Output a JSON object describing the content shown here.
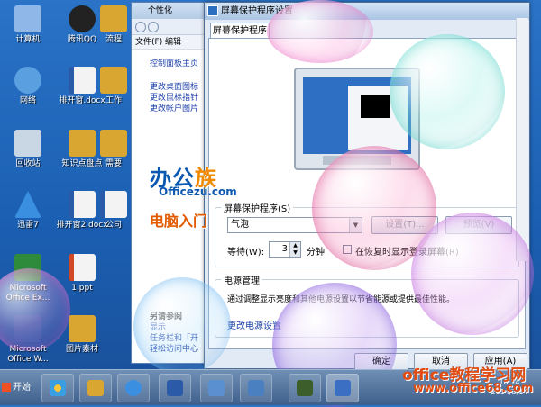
{
  "desktop": {
    "icons": [
      {
        "label": "计算机"
      },
      {
        "label": "腾讯QQ"
      },
      {
        "label": "流程"
      },
      {
        "label": "网络"
      },
      {
        "label": "排开窗.docx"
      },
      {
        "label": "工作"
      },
      {
        "label": "回收站"
      },
      {
        "label": "知识点盘点"
      },
      {
        "label": "需要"
      },
      {
        "label": "迅雷7"
      },
      {
        "label": "排开窗2.docx"
      },
      {
        "label": "公司"
      },
      {
        "label": "Microsoft Office Ex..."
      },
      {
        "label": "1.ppt"
      },
      {
        "label": "Microsoft Office W..."
      },
      {
        "label": "图片素材"
      }
    ]
  },
  "explorer": {
    "title": "个性化",
    "menu": "文件(F)    编辑",
    "home_link": "控制面板主页",
    "links": [
      "更改桌面图标",
      "更改鼠标指针",
      "更改帐户图片"
    ],
    "see_also_title": "另请参阅",
    "see_also": [
      "显示",
      "任务栏和「开",
      "轻松访问中心"
    ]
  },
  "dialog": {
    "title": "屏幕保护程序设置",
    "tab": "屏幕保护程序",
    "screensaver_group": "屏幕保护程序(S)",
    "screensaver_value": "气泡",
    "settings_button": "设置(T)...",
    "preview_button": "预览(V)",
    "wait_label": "等待(W):",
    "wait_value": "3",
    "minutes_label": "分钟",
    "resume_label": "在恢复时显示登录屏幕(R)",
    "power_group": "电源管理",
    "power_text": "通过调整显示亮度和其他电源设置以节省能源或提供最佳性能。",
    "power_link": "更改电源设置",
    "ok_button": "确定",
    "cancel_button": "取消",
    "apply_button": "应用(A)"
  },
  "logo": {
    "text1_a": "办公",
    "text1_b": "族",
    "text2": "Officezu.com",
    "text3": "电脑入门"
  },
  "taskbar": {
    "start_label": "开始",
    "time": "10:14",
    "date": "2014/3/14"
  },
  "watermark": {
    "line1": "office教程学习网",
    "line2": "www.office68.com"
  }
}
